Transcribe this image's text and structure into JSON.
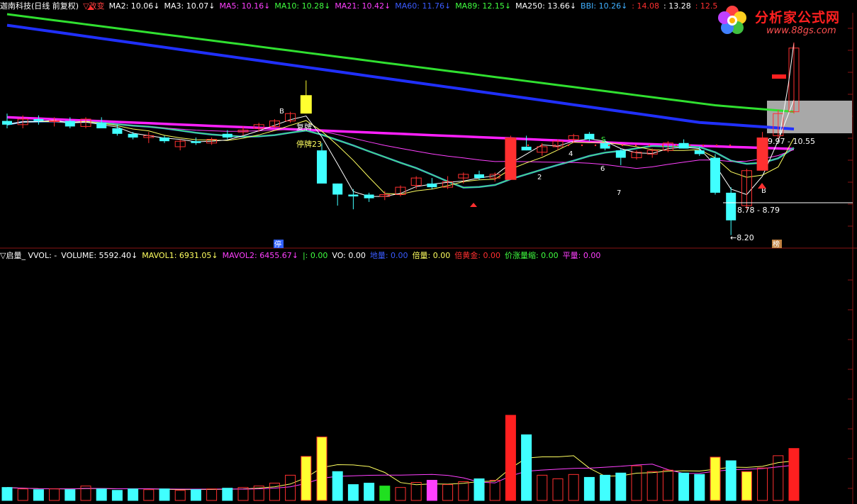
{
  "header": {
    "title": "迦南科技(日线 前复权)",
    "formula_label": "▽改变",
    "indicators": [
      {
        "label": "MA2",
        "value": "10.06",
        "dir": "↓",
        "color": "#ffffff"
      },
      {
        "label": "MA3",
        "value": "10.07",
        "dir": "↓",
        "color": "#ffffff"
      },
      {
        "label": "MA5",
        "value": "10.16",
        "dir": "↓",
        "color": "#ff40ff"
      },
      {
        "label": "MA10",
        "value": "10.28",
        "dir": "↓",
        "color": "#40ff40"
      },
      {
        "label": "MA21",
        "value": "10.42",
        "dir": "↓",
        "color": "#ff40ff"
      },
      {
        "label": "MA60",
        "value": "11.76",
        "dir": "↓",
        "color": "#3a5bff"
      },
      {
        "label": "MA89",
        "value": "12.15",
        "dir": "↓",
        "color": "#40ff40"
      },
      {
        "label": "MA250",
        "value": "13.66",
        "dir": "↓",
        "color": "#ffffff"
      },
      {
        "label": "BBI",
        "value": "10.26",
        "dir": "↓",
        "color": "#40b0ff"
      },
      {
        "label": "",
        "value": "14.08",
        "dir": "",
        "color": "#ff3030"
      },
      {
        "label": "",
        "value": "13.28",
        "dir": "",
        "color": "#ffffff"
      },
      {
        "label": "",
        "value": "12.5",
        "dir": "",
        "color": "#ff3030"
      }
    ]
  },
  "watermark": {
    "title": "分析家公式网",
    "url": "www.88gs.com"
  },
  "price_panel": {
    "annotations": {
      "fupai": "复牌",
      "tingpai": "停牌23",
      "range_label": "9.97 - 10.55",
      "support_label": "8.78 - 8.79",
      "low_label": "←8.20",
      "b_mark": "B",
      "b_mark2": "B",
      "s_mark": "S",
      "num2": "2",
      "num4": "4",
      "num6": "6",
      "num7": "7",
      "ting_badge": "停",
      "bang_badge": "榜",
      "x_mark": "X"
    }
  },
  "volume_header": {
    "items": [
      {
        "text": "▽启量_ VVOL: -",
        "color": "#ffffff"
      },
      {
        "text": "VOLUME: 5592.40↓",
        "color": "#ffffff"
      },
      {
        "text": "MAVOL1: 6931.05↓",
        "color": "#ffff60"
      },
      {
        "text": "MAVOL2: 6455.67↓",
        "color": "#ff40ff"
      },
      {
        "text": "|: 0.00",
        "color": "#40ff40"
      },
      {
        "text": "VO: 0.00",
        "color": "#ffffff"
      },
      {
        "text": "地量: 0.00",
        "color": "#3a5bff"
      },
      {
        "text": "倍量: 0.00",
        "color": "#ffff60"
      },
      {
        "text": "倍黄金: 0.00",
        "color": "#ff3030"
      },
      {
        "text": "价涨量缩: 0.00",
        "color": "#40ff40"
      },
      {
        "text": "平量: 0.00",
        "color": "#ff40ff"
      }
    ]
  },
  "chart_data": [
    {
      "type": "candlestick",
      "title": "迦南科技(日线 前复权)",
      "ylim": [
        8.0,
        14.2
      ],
      "ohlc": [
        [
          11.3,
          11.5,
          11.1,
          11.2
        ],
        [
          11.2,
          11.45,
          11.1,
          11.35
        ],
        [
          11.35,
          11.45,
          11.2,
          11.3
        ],
        [
          11.3,
          11.4,
          11.15,
          11.3
        ],
        [
          11.3,
          11.4,
          11.1,
          11.15
        ],
        [
          11.15,
          11.4,
          11.1,
          11.35
        ],
        [
          11.25,
          11.4,
          11.1,
          11.1
        ],
        [
          11.1,
          11.2,
          10.9,
          10.95
        ],
        [
          10.95,
          11.0,
          10.8,
          10.85
        ],
        [
          10.85,
          11.0,
          10.7,
          10.9
        ],
        [
          10.85,
          10.9,
          10.7,
          10.75
        ],
        [
          10.6,
          10.8,
          10.5,
          10.75
        ],
        [
          10.75,
          10.85,
          10.65,
          10.7
        ],
        [
          10.7,
          10.85,
          10.65,
          10.8
        ],
        [
          10.95,
          11.05,
          10.8,
          10.85
        ],
        [
          11.0,
          11.15,
          10.9,
          11.05
        ],
        [
          11.1,
          11.25,
          11.0,
          11.2
        ],
        [
          11.15,
          11.35,
          11.1,
          11.3
        ],
        [
          11.3,
          11.55,
          11.25,
          11.5
        ],
        [
          12.0,
          12.4,
          11.6,
          11.5
        ],
        [
          10.5,
          10.7,
          10.0,
          9.6
        ],
        [
          9.6,
          9.6,
          9.0,
          9.3
        ],
        [
          9.3,
          9.45,
          8.9,
          9.25
        ],
        [
          9.3,
          9.35,
          9.1,
          9.2
        ],
        [
          9.25,
          9.4,
          9.15,
          9.3
        ],
        [
          9.3,
          9.55,
          9.25,
          9.5
        ],
        [
          9.55,
          9.8,
          9.45,
          9.75
        ],
        [
          9.6,
          9.75,
          9.45,
          9.5
        ],
        [
          9.5,
          9.8,
          9.45,
          9.65
        ],
        [
          9.75,
          9.9,
          9.6,
          9.85
        ],
        [
          9.85,
          9.95,
          9.7,
          9.75
        ],
        [
          9.75,
          9.9,
          9.65,
          9.85
        ],
        [
          9.7,
          10.9,
          9.7,
          10.85
        ],
        [
          10.6,
          10.9,
          10.5,
          10.5
        ],
        [
          10.45,
          10.7,
          10.35,
          10.6
        ],
        [
          10.6,
          10.8,
          10.5,
          10.75
        ],
        [
          10.8,
          10.95,
          10.7,
          10.9
        ],
        [
          10.95,
          11.0,
          10.75,
          10.8
        ],
        [
          10.7,
          10.8,
          10.5,
          10.55
        ],
        [
          10.5,
          10.55,
          10.1,
          10.3
        ],
        [
          10.3,
          10.5,
          10.25,
          10.45
        ],
        [
          10.4,
          10.55,
          10.3,
          10.5
        ],
        [
          10.5,
          10.75,
          10.45,
          10.7
        ],
        [
          10.7,
          10.8,
          10.55,
          10.55
        ],
        [
          10.5,
          10.6,
          10.35,
          10.4
        ],
        [
          10.3,
          10.4,
          9.3,
          9.35
        ],
        [
          9.35,
          9.5,
          8.2,
          8.6
        ],
        [
          9.0,
          10.0,
          8.9,
          9.95
        ],
        [
          9.95,
          11.0,
          9.95,
          10.85
        ],
        [
          10.9,
          11.6,
          10.8,
          11.5
        ],
        [
          11.55,
          13.3,
          11.5,
          13.28
        ]
      ],
      "ma_series": [
        "MA5",
        "MA10",
        "MA21",
        "MA60",
        "MA89",
        "MA250",
        "BBI"
      ]
    },
    {
      "type": "bar",
      "title": "启量",
      "volume": [
        18,
        16,
        15,
        16,
        15,
        20,
        16,
        14,
        16,
        15,
        16,
        14,
        15,
        16,
        17,
        18,
        20,
        24,
        35,
        61,
        88,
        40,
        22,
        24,
        20,
        18,
        25,
        28,
        22,
        26,
        30,
        28,
        118,
        91,
        35,
        30,
        36,
        32,
        35,
        38,
        48,
        40,
        42,
        38,
        36,
        60,
        55,
        40,
        45,
        62,
        72
      ],
      "ylim": [
        0,
        330
      ]
    }
  ]
}
